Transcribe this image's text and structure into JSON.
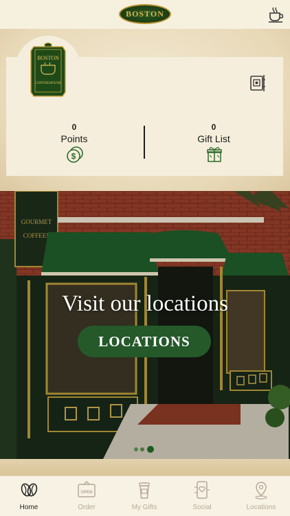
{
  "brand": {
    "logo_text": "BOSTON",
    "badge_line1": "BOSTON",
    "badge_line2": "COFFEEHOUSE"
  },
  "rewards": {
    "points_value": "0",
    "points_label": "Points",
    "gifts_value": "0",
    "gifts_label": "Gift List"
  },
  "hero": {
    "headline": "Visit our locations",
    "button_label": "LOCATIONS",
    "slide_count": 3,
    "active_slide": 3
  },
  "nav": {
    "items": [
      {
        "label": "Home",
        "icon": "coffee-beans-icon",
        "active": true
      },
      {
        "label": "Order",
        "icon": "open-sign-icon",
        "active": false
      },
      {
        "label": "My Gifts",
        "icon": "gift-cup-icon",
        "active": false
      },
      {
        "label": "Social",
        "icon": "phone-heart-icon",
        "active": false
      },
      {
        "label": "Locations",
        "icon": "map-pin-icon",
        "active": false
      }
    ]
  },
  "colors": {
    "brand_green": "#25592a",
    "gold": "#b8922e",
    "parchment": "#f5eedc"
  }
}
